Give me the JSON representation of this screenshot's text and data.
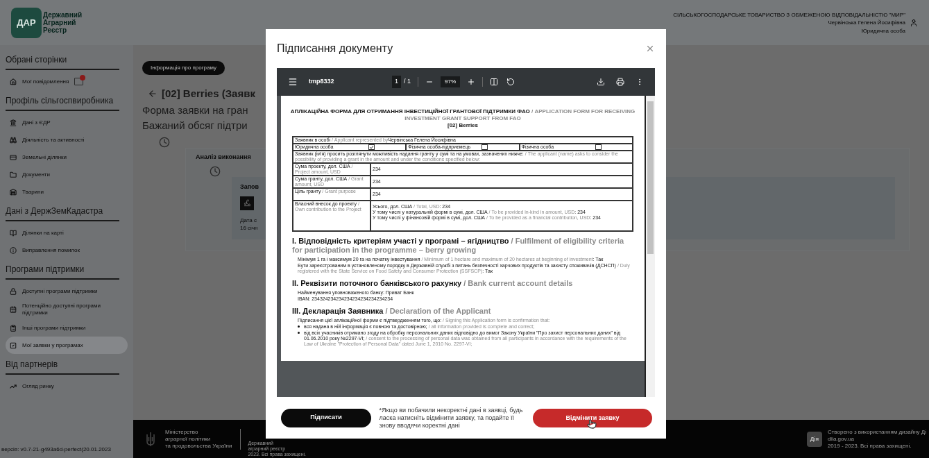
{
  "header": {
    "logo_mark": "ДАР",
    "logo_name": "Державний\nАграрний\nРеєстр",
    "company": "СІЛЬСЬКОГОСПОДАРСЬКЕ ТОВАРИСТВО З ОБМЕЖЕНОЮ ВІДПОВІДАЛЬНІСТЮ \"МИР\"",
    "user": "Червінська Гелена Йосифівна",
    "role": "Юридична особа"
  },
  "sidebar": {
    "sections": [
      {
        "title": "Обрані сторінки",
        "items": [
          {
            "label": "Мої повідомлення",
            "kind": "home",
            "selected": false,
            "unread": true
          }
        ]
      },
      {
        "title": "Профіль сільгоспвиробника",
        "items": [
          {
            "label": "Дані з ЄДР",
            "kind": "bank",
            "selected": false
          },
          {
            "label": "Діяльність та активності",
            "kind": "binoculars",
            "selected": false
          },
          {
            "label": "Земельні ділянки",
            "kind": "card",
            "selected": false
          },
          {
            "label": "Документи",
            "kind": "folder",
            "selected": false
          },
          {
            "label": "Тварини",
            "kind": "barn",
            "selected": false
          }
        ]
      },
      {
        "title": "Дані з ДержЗемКадастра",
        "items": [
          {
            "label": "Ділянки на карті",
            "kind": "book",
            "selected": false
          },
          {
            "label": "Виправлення помилок",
            "kind": "info",
            "selected": false
          }
        ]
      },
      {
        "title": "Програми підтримки",
        "items": [
          {
            "label": "Доступні програми підтримки",
            "kind": "lock",
            "selected": false
          },
          {
            "label": "Потенційно доступні програми підтримки",
            "kind": "calendar",
            "selected": false
          },
          {
            "label": "Інші програми підтримки",
            "kind": "clipboard",
            "selected": false
          },
          {
            "label": "Мої заявки у програмах",
            "kind": "check",
            "selected": true
          }
        ]
      },
      {
        "title": "Від партнерів",
        "items": [
          {
            "label": "Огляд ринку",
            "kind": "chart",
            "selected": false
          }
        ]
      }
    ],
    "version": "версія: v0.7-21-g493a6d-perfect(20.01.2023"
  },
  "main": {
    "info_button": "Інформація про програму",
    "title": "[02] Berries (Заявк",
    "subtitle_1": "Форма заявки на гран",
    "subtitle_2": "Бажаний обсяг підтри",
    "stage": "Аналіз виконання",
    "card_title": "Запов",
    "date_label": "Дата с",
    "date_value": "16 січн"
  },
  "footer": {
    "ministry": "Міністерство\nаграрної політики\nта продовольства України",
    "registry": "Державний\nаграрний реєстр\n2023. Всі права захищені.",
    "dia_badge": "Дія",
    "credits": "Створено з використанням дизайну Ді\ndiia.gov.ua\n2019 - 2023. Всі права захищені."
  },
  "modal": {
    "title": "Підписання документу",
    "viewer": {
      "file": "tmp8332",
      "page": "1",
      "pages": "/ 1",
      "zoom": "97%"
    },
    "document": {
      "title_ua": "АПЛІКАЦІЙНА ФОРМА ДЛЯ ОТРИМАННЯ ІНВЕСТИЦІЙНОЇ ГРАНТОВОЇ ПІДТРИМКИ ФАО",
      "title_en": "/ APPLICATION FORM FOR RECEIVING INVESTMENT GRANT SUPPORT FROM FAO",
      "program": "[02] Berries",
      "applicant": {
        "ua": "Заявник в особі",
        "en": "/ Applicant represented by",
        "value": "Червінська Гелена Йосифівна"
      },
      "person_types": [
        {
          "label": "Юридична особа",
          "checked": true
        },
        {
          "label": "Фізична особа-підприємець",
          "checked": false
        },
        {
          "label": "Фізична особа",
          "checked": false
        }
      ],
      "request": {
        "ua": "Заявник (ім'я) просить розглянути можливість надання гранту у сумі та на умовах, зазначених нижче:",
        "en": "/ The applicant (name) asks to consider the possibility of providing a grant in the amount and under the conditions specified below:"
      },
      "amounts": [
        {
          "ua": "Сума проекту, дол. США",
          "en": "/ Project amount, USD",
          "value": "234"
        },
        {
          "ua": "Сума гранту, дол. США",
          "en": "/ Grant amount, USD",
          "value": "234"
        },
        {
          "ua": "Ціль гранту",
          "en": "/ Grant purpose",
          "value": "234"
        }
      ],
      "contribution": {
        "ua": "Власний внесок до проекту",
        "en": "/ Own contribution to the Project",
        "lines": [
          {
            "ua": "Усього, дол. США",
            "en": "/ Total, USD",
            "value": ": 234"
          },
          {
            "ua": "У тому числі у натуральній формі в сумі, дол. США",
            "en": "/ To be provided in-kind in amount, USD",
            "value": ": 234"
          },
          {
            "ua": "У тому числі у фінансовій формі в сумі, дол. США",
            "en": "/ To be provided as a financial contribution, USD",
            "value": ": 234"
          }
        ]
      },
      "sections": [
        {
          "ua": "I. Відповідність критеріям участі у програмі – ягідництво",
          "en": "/ Fulfilment of eligibility criteria for participation in the programme – berry growing",
          "lines": [
            {
              "ua": "Мінімум 1 га і максимум 20 га на початку інвестування",
              "en": "/ Minimum of 1 hectare and maximum of 20 hectares at beginning of investment",
              "value": ": Так"
            },
            {
              "ua": "Бути зареєстрованим в установленому порядку в Державній службі з питань безпечності харчових продуктів та захисту споживачів (ДСНСП)",
              "en": "/ Duly registered with the State Service on Food Safety and Consumer Protection (SSFSCP)",
              "value": ": Так"
            }
          ]
        },
        {
          "ua": "II. Реквізити поточного банківського рахунку",
          "en": "/ Bank current account details",
          "lines": [
            {
              "ua": "Найменування уповноваженого банку: Приват Банк"
            },
            {
              "ua": "IBAN: 234324234234234234234234234234"
            }
          ]
        },
        {
          "ua": "III. Декларація Заявника",
          "en": "/ Declaration of the Applicant",
          "lines": [
            {
              "ua": "Підписання цієї аплікаційної форми є підтвердженням того, що:",
              "en": "/ Signing this Application form is confirmation that:"
            }
          ],
          "bullets": [
            {
              "ua": "вся надана в ній інформація є повною та достовірною;",
              "en": "/ all information provided is complete and correct;"
            },
            {
              "ua": "від всіх учасників отримано згоду на обробку персональних даних відповідно до вимог Закону України \"Про захист персональних даних\" від 01.06.2010 року №2297-VI;",
              "en": "/ consent to the processing of personal data was obtained from all participants in accordance with the requirements of the Law of Ukraine \"Protection of Personal Data\" dated June 1, 2010 No. 2297-VI;"
            }
          ]
        }
      ]
    },
    "sign_button": "Підписати",
    "note": "*Якщо ви побачили некоректні дані в заявці, будь ласка натисніть відмінити заявку, та подайте її знову вводячи коректні дані",
    "cancel_button": "Відмінити заявку"
  }
}
